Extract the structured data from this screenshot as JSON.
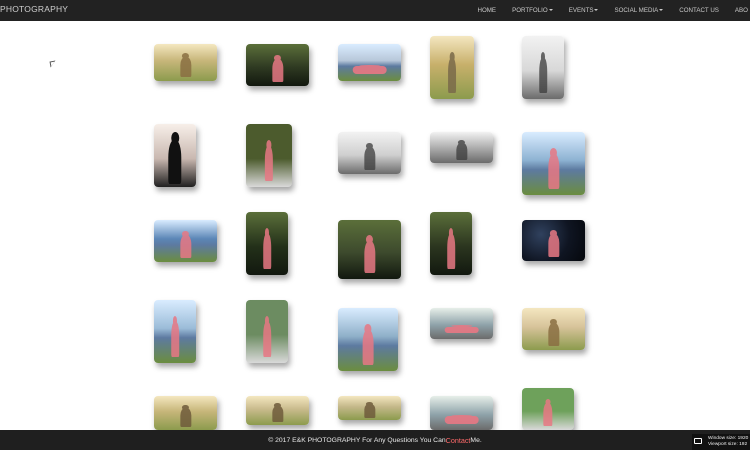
{
  "brand": {
    "title": "PHOTOGRAPHY"
  },
  "nav": {
    "items": [
      {
        "label": "HOME",
        "dropdown": false
      },
      {
        "label": "PORTFOLIO",
        "dropdown": true
      },
      {
        "label": "EVENTS",
        "dropdown": true
      },
      {
        "label": "SOCIAL MEDIA",
        "dropdown": true
      },
      {
        "label": "CONTACT US",
        "dropdown": false
      },
      {
        "label": "ABO",
        "dropdown": false
      }
    ]
  },
  "footer": {
    "text_before": "© 2017 E&K PHOTOGRAPHY For Any Questions You Can ",
    "link": "Contact",
    "text_after": " Me."
  },
  "overlay": {
    "window_label": "Window size:",
    "window_value": "1920",
    "viewport_label": "Viewport size:",
    "viewport_value": "192"
  },
  "colors": {
    "nav_bg": "#222222",
    "footer_bg": "#1f1f1f",
    "contact_link": "#ff6a6a",
    "dress_pink": "#e87884"
  },
  "thumbs": [
    {
      "bg": "#c7b67a",
      "accent": "#8a6f42",
      "style": "meadow"
    },
    {
      "bg": "#2f3a22",
      "accent": "#e87884",
      "style": "forest"
    },
    {
      "bg": "#b7c7d9",
      "accent": "#e87884",
      "style": "lake-fabric"
    },
    {
      "bg": "#c8b06b",
      "accent": "#7a6a4a",
      "style": "field"
    },
    {
      "bg": "#d8d8d8",
      "accent": "#3c3c3c",
      "style": "bw"
    },
    {
      "bg": "#efe6e4",
      "accent": "#111111",
      "style": "silhouette"
    },
    {
      "bg": "#4c5b2d",
      "accent": "#e87884",
      "style": "couple"
    },
    {
      "bg": "#cfcfcf",
      "accent": "#2d2d2d",
      "style": "bw"
    },
    {
      "bg": "#a8a8a8",
      "accent": "#4b4b4b",
      "style": "bw"
    },
    {
      "bg": "#8db2d2",
      "accent": "#e87884",
      "style": "lake"
    },
    {
      "bg": "#5b86b6",
      "accent": "#e87884",
      "style": "lake-couple"
    },
    {
      "bg": "#233019",
      "accent": "#e87884",
      "style": "dark-forest"
    },
    {
      "bg": "#3d4a2d",
      "accent": "#e87884",
      "style": "belly"
    },
    {
      "bg": "#2b351f",
      "accent": "#e87884",
      "style": "walk"
    },
    {
      "bg": "#0f1522",
      "accent": "#e87884",
      "style": "night"
    },
    {
      "bg": "#9bbcd8",
      "accent": "#e87884",
      "style": "profile"
    },
    {
      "bg": "#6c8c61",
      "accent": "#e87884",
      "style": "closeup"
    },
    {
      "bg": "#8fb0c9",
      "accent": "#e87884",
      "style": "sign"
    },
    {
      "bg": "#8ea2a9",
      "accent": "#e87884",
      "style": "rock"
    },
    {
      "bg": "#d7c39a",
      "accent": "#8a6f42",
      "style": "wildflowers"
    },
    {
      "bg": "#c7b67a",
      "accent": "#6f5b3b",
      "style": "meadow"
    },
    {
      "bg": "#c9bb8d",
      "accent": "#6f5b3b",
      "style": "meadow"
    },
    {
      "bg": "#c4b88a",
      "accent": "#6f5b3b",
      "style": "meadow"
    },
    {
      "bg": "#8ea2a9",
      "accent": "#e87884",
      "style": "rock"
    },
    {
      "bg": "#6ea15b",
      "accent": "#e87884",
      "style": "couple"
    }
  ]
}
